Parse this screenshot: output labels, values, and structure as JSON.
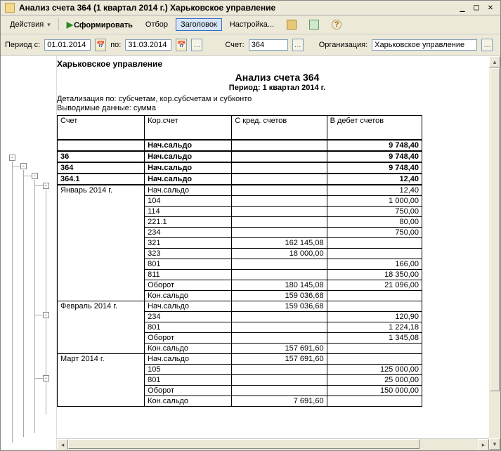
{
  "window": {
    "title": "Анализ счета 364 (1 квартал 2014 г.) Харьковское управление"
  },
  "toolbar": {
    "actions": "Действия",
    "form": "Сформировать",
    "filter": "Отбор",
    "header": "Заголовок",
    "settings": "Настройка...",
    "help_glyph": "?"
  },
  "filter": {
    "period_from_lbl": "Период с:",
    "date_from": "01.01.2014",
    "to_lbl": "по:",
    "date_to": "31.03.2014",
    "acct_lbl": "Счет:",
    "acct": "364",
    "org_lbl": "Организация:",
    "org": "Харьковское управление"
  },
  "report": {
    "h1": "Харьковское управление",
    "h2": "Анализ счета 364",
    "h3": "Период: 1 квартал 2014 г.",
    "detail": "Детализация по: субсчетам, кор.субсчетам и субконто",
    "outdata": "Выводимые данные: сумма",
    "col1": "Счет",
    "col2": "Кор.счет",
    "col3": "С кред. счетов",
    "col4": "В дебет счетов",
    "txt_nach": "Нач.сальдо",
    "txt_oborot": "Оборот",
    "txt_kon": "Кон.сальдо",
    "rows": {
      "top_deb": "9 748,40",
      "r36_acc": "36",
      "r36_deb": "9 748,40",
      "r364_acc": "364",
      "r364_deb": "9 748,40",
      "r3641_acc": "364.1",
      "r3641_deb": "12,40",
      "jan": "Январь 2014 г.",
      "jan_nach_deb": "12,40",
      "jan_104_cor": "104",
      "jan_104_deb": "1 000,00",
      "jan_114_cor": "114",
      "jan_114_deb": "750,00",
      "jan_2211_cor": "221.1",
      "jan_2211_deb": "80,00",
      "jan_234_cor": "234",
      "jan_234_deb": "750,00",
      "jan_321_cor": "321",
      "jan_321_kr": "162 145,08",
      "jan_323_cor": "323",
      "jan_323_kr": "18 000,00",
      "jan_801_cor": "801",
      "jan_801_deb": "166,00",
      "jan_811_cor": "811",
      "jan_811_deb": "18 350,00",
      "jan_ob_kr": "180 145,08",
      "jan_ob_deb": "21 096,00",
      "jan_kon_kr": "159 036,68",
      "feb": "Февраль 2014 г.",
      "feb_nach_kr": "159 036,68",
      "feb_234_cor": "234",
      "feb_234_deb": "120,90",
      "feb_801_cor": "801",
      "feb_801_deb": "1 224,18",
      "feb_ob_deb": "1 345,08",
      "feb_kon_kr": "157 691,60",
      "mar": "Март 2014 г.",
      "mar_nach_kr": "157 691,60",
      "mar_105_cor": "105",
      "mar_105_deb": "125 000,00",
      "mar_801_cor": "801",
      "mar_801_deb": "25 000,00",
      "mar_ob_deb": "150 000,00",
      "mar_kon_kr": "7 691,60"
    }
  }
}
